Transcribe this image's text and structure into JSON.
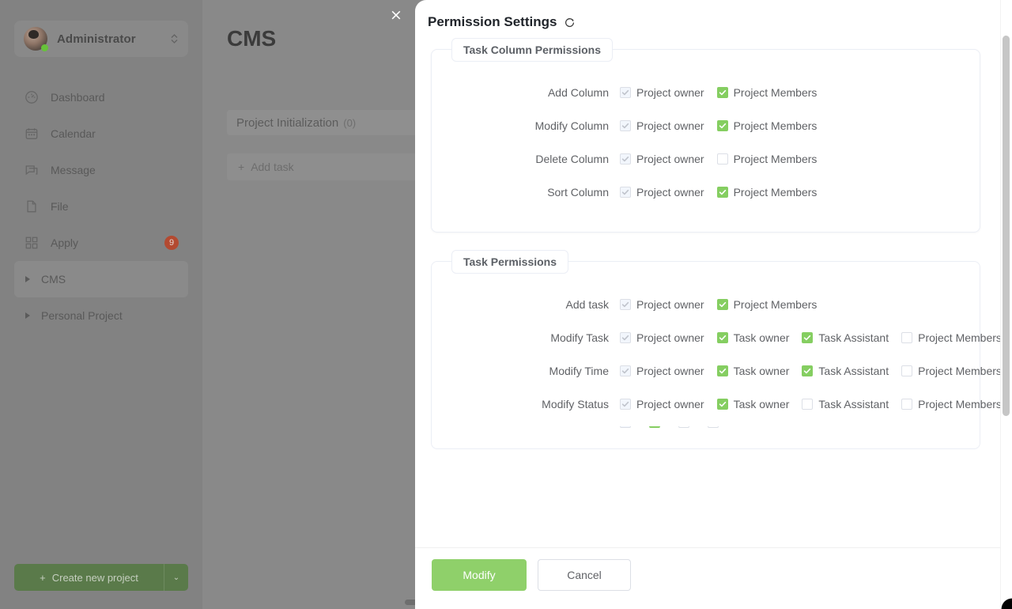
{
  "overlay": {
    "close_label": "×"
  },
  "sidebar": {
    "user": {
      "name": "Administrator",
      "switch_icon": "chevron-up-down-icon"
    },
    "items": [
      {
        "label": "Dashboard",
        "icon": "dashboard-icon",
        "badge": "",
        "active": false,
        "expandable": false
      },
      {
        "label": "Calendar",
        "icon": "calendar-icon",
        "badge": "",
        "active": false,
        "expandable": false
      },
      {
        "label": "Message",
        "icon": "message-icon",
        "badge": "",
        "active": false,
        "expandable": false
      },
      {
        "label": "File",
        "icon": "file-icon",
        "badge": "",
        "active": false,
        "expandable": false
      },
      {
        "label": "Apply",
        "icon": "apps-grid-icon",
        "badge": "9",
        "active": false,
        "expandable": false
      },
      {
        "label": "CMS",
        "icon": "triangle-right-icon",
        "badge": "",
        "active": true,
        "expandable": true
      },
      {
        "label": "Personal Project",
        "icon": "triangle-right-icon",
        "badge": "",
        "active": false,
        "expandable": true
      }
    ],
    "create_project": {
      "label": "Create new project",
      "plus": "+",
      "caret": "⌄"
    }
  },
  "background_main": {
    "title": "CMS",
    "column": {
      "name": "Project Initialization",
      "count": "(0)",
      "menu": "···"
    },
    "add_task": {
      "plus": "+",
      "label": "Add task"
    }
  },
  "drawer": {
    "title": "Permission Settings",
    "refresh_icon": "refresh-icon",
    "sections": [
      {
        "legend": "Task Column Permissions",
        "rows": [
          {
            "label": "Add Column",
            "checks": [
              {
                "label": "Project owner",
                "state": "disabled-checked"
              },
              {
                "label": "Project Members",
                "state": "checked"
              }
            ]
          },
          {
            "label": "Modify Column",
            "checks": [
              {
                "label": "Project owner",
                "state": "disabled-checked"
              },
              {
                "label": "Project Members",
                "state": "checked"
              }
            ]
          },
          {
            "label": "Delete Column",
            "checks": [
              {
                "label": "Project owner",
                "state": "disabled-checked"
              },
              {
                "label": "Project Members",
                "state": "unchecked"
              }
            ]
          },
          {
            "label": "Sort Column",
            "checks": [
              {
                "label": "Project owner",
                "state": "disabled-checked"
              },
              {
                "label": "Project Members",
                "state": "checked"
              }
            ]
          }
        ]
      },
      {
        "legend": "Task Permissions",
        "rows": [
          {
            "label": "Add task",
            "checks": [
              {
                "label": "Project owner",
                "state": "disabled-checked"
              },
              {
                "label": "Project Members",
                "state": "checked"
              }
            ]
          },
          {
            "label": "Modify Task",
            "checks": [
              {
                "label": "Project owner",
                "state": "disabled-checked"
              },
              {
                "label": "Task owner",
                "state": "checked"
              },
              {
                "label": "Task Assistant",
                "state": "checked"
              },
              {
                "label": "Project Members",
                "state": "unchecked"
              }
            ]
          },
          {
            "label": "Modify Time",
            "checks": [
              {
                "label": "Project owner",
                "state": "disabled-checked"
              },
              {
                "label": "Task owner",
                "state": "checked"
              },
              {
                "label": "Task Assistant",
                "state": "checked"
              },
              {
                "label": "Project Members",
                "state": "unchecked"
              }
            ]
          },
          {
            "label": "Modify Status",
            "checks": [
              {
                "label": "Project owner",
                "state": "disabled-checked"
              },
              {
                "label": "Task owner",
                "state": "checked"
              },
              {
                "label": "Task Assistant",
                "state": "unchecked"
              },
              {
                "label": "Project Members",
                "state": "unchecked"
              }
            ]
          },
          {
            "label": "",
            "clipped": true,
            "checks": [
              {
                "label": "",
                "state": "disabled-checked"
              },
              {
                "label": "",
                "state": "checked"
              },
              {
                "label": "",
                "state": "unchecked"
              },
              {
                "label": "",
                "state": "unchecked"
              }
            ]
          }
        ]
      }
    ],
    "footer": {
      "modify_label": "Modify",
      "cancel_label": "Cancel"
    }
  },
  "colors": {
    "accent_green": "#85ce61",
    "button_green": "#8fd06a",
    "badge_red": "#b34a31",
    "overlay_gray": "#898989",
    "sidebar_gray": "#828282"
  }
}
